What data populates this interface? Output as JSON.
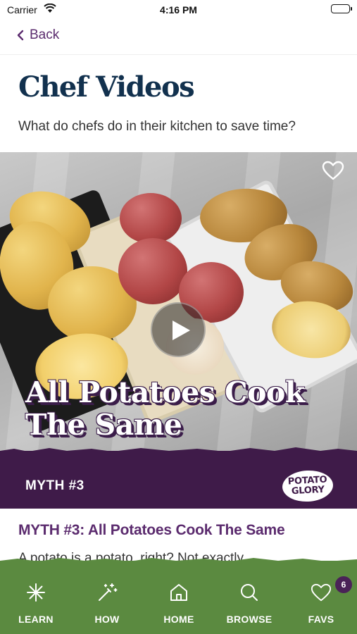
{
  "status_bar": {
    "carrier": "Carrier",
    "time": "4:16 PM"
  },
  "nav": {
    "back_label": "Back"
  },
  "header": {
    "title": "Chef Videos",
    "subtitle": "What do chefs do in their kitchen to save time?"
  },
  "video": {
    "overlay_title_line1": "All Potatoes Cook",
    "overlay_title_line2": "The Same",
    "myth_label": "MYTH #3",
    "logo_line1": "POTATO",
    "logo_line2": "GLORY",
    "favorited": false
  },
  "article": {
    "title": "MYTH #3: All Potatoes Cook The Same",
    "excerpt": "A potato is a potato, right? Not exactly..."
  },
  "tabs": [
    {
      "label": "LEARN",
      "icon": "sparkle-icon"
    },
    {
      "label": "HOW",
      "icon": "magic-wand-icon"
    },
    {
      "label": "HOME",
      "icon": "home-icon"
    },
    {
      "label": "BROWSE",
      "icon": "search-icon"
    },
    {
      "label": "FAVS",
      "icon": "heart-icon",
      "badge": "6"
    }
  ],
  "colors": {
    "title_navy": "#12314e",
    "accent_purple": "#5b2b6e",
    "myth_band": "#3f1b49",
    "tab_bar_green": "#5b8a40"
  }
}
